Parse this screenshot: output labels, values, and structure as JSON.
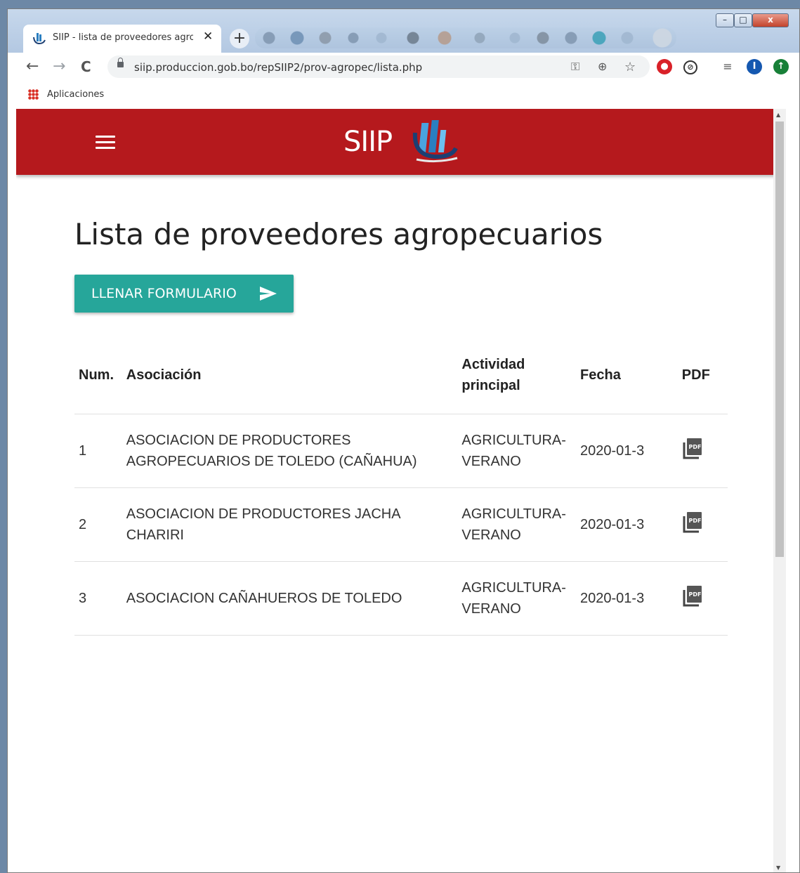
{
  "browser": {
    "tab_title": "SIIP - lista de proveedores agropecuarios",
    "tab_close": "✕",
    "new_tab": "+",
    "url": "siip.produccion.gob.bo/repSIIP2/prov-agropec/lista.php",
    "bookmarks": {
      "apps_label": "Aplicaciones"
    },
    "window_controls": {
      "minimize": "–",
      "maximize": "□",
      "close": "x"
    },
    "nav": {
      "back": "←",
      "forward": "→",
      "reload": "C"
    },
    "extensions": {
      "profile_initial": "I"
    }
  },
  "site": {
    "logo_text": "SIIP",
    "brand_color": "#b5191d"
  },
  "main": {
    "title": "Lista de proveedores agropecuarios",
    "cta_label": "LLENAR FORMULARIO",
    "accent_color": "#26a69a",
    "table": {
      "headers": {
        "num": "Num.",
        "asociacion": "Asociación",
        "actividad": "Actividad principal",
        "fecha": "Fecha",
        "pdf": "PDF"
      },
      "rows": [
        {
          "num": "1",
          "asociacion": "ASOCIACION DE PRODUCTORES AGROPECUARIOS DE TOLEDO (CAÑAHUA)",
          "actividad": "AGRICULTURA-VERANO",
          "fecha": "2020-01-3",
          "pdf_icon": "pdf-icon"
        },
        {
          "num": "2",
          "asociacion": "ASOCIACION DE PRODUCTORES JACHA CHARIRI",
          "actividad": "AGRICULTURA-VERANO",
          "fecha": "2020-01-3",
          "pdf_icon": "pdf-icon"
        },
        {
          "num": "3",
          "asociacion": "ASOCIACION CAÑAHUEROS DE TOLEDO",
          "actividad": "AGRICULTURA-VERANO",
          "fecha": "2020-01-3",
          "pdf_icon": "pdf-icon"
        }
      ]
    }
  }
}
